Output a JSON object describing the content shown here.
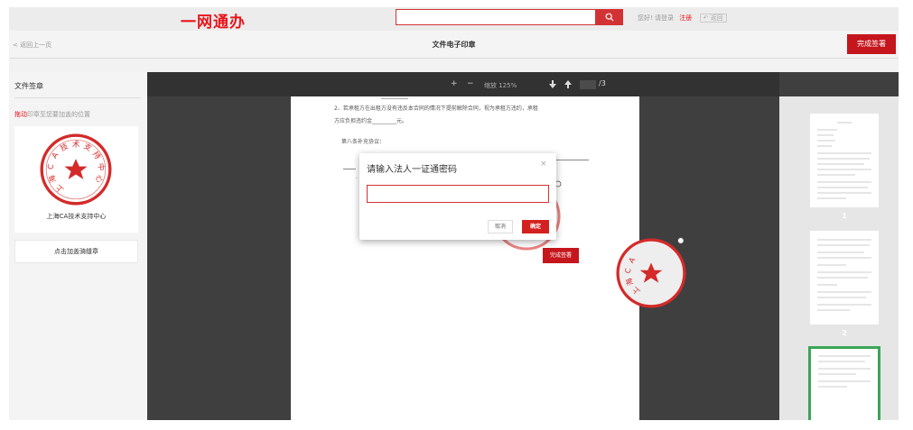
{
  "header": {
    "logo": "一网通办",
    "search_icon": "search-icon",
    "greeting": "您好! 请登录",
    "register": "注册",
    "back_home": "返回"
  },
  "subbar": {
    "back": "< 返回上一页",
    "title": "文件电子印章",
    "finish_label": "完成签署"
  },
  "left_panel": {
    "title": "文件签章",
    "hint_drag": "拖动",
    "hint_text": "印章至您要加盖的位置",
    "seal_name": "上海CA技术支持中心",
    "add_seal": "点击加盖骑缝章"
  },
  "seal": {
    "text": "上海CA技术支持中心",
    "color": "#d42a2a"
  },
  "toolbar": {
    "plus": "+",
    "minus": "−",
    "zoom": "缩放 125%",
    "down_icon": "arrow-down-icon",
    "up_icon": "arrow-up-icon",
    "page_total": "/3"
  },
  "document": {
    "line1": "2、若承租方在出租方没有违反本合同的情况下提前解除合同，视为承租方违约，承租",
    "line2": "方应负担违约金_________元。",
    "line3": "第八条补充协议：",
    "finish_label": "完成签署"
  },
  "thumbnails": [
    {
      "num": "1"
    },
    {
      "num": "2"
    },
    {
      "num": "3"
    }
  ],
  "modal": {
    "title": "请输入法人一证通密码",
    "close": "×",
    "input_value": "",
    "cancel": "取消",
    "ok": "确定"
  },
  "colors": {
    "brand": "#e8141b",
    "accent": "#c4161c",
    "thumb_active": "#3aa757"
  }
}
